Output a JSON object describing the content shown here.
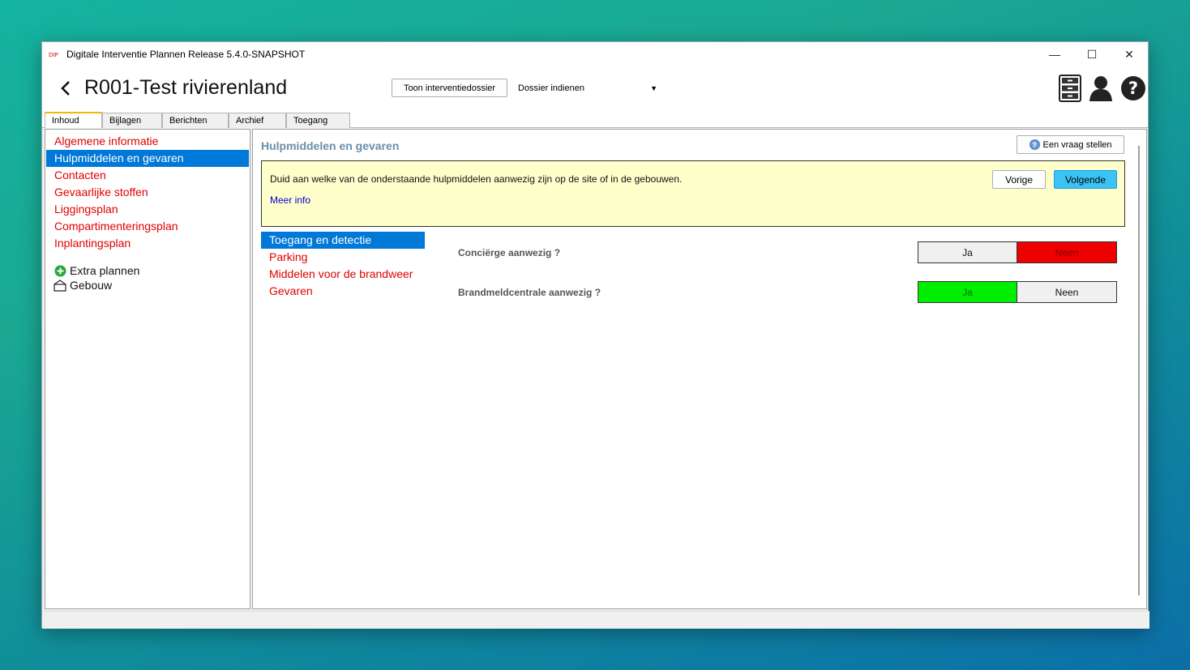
{
  "window": {
    "title": "Digitale Interventie Plannen Release 5.4.0-SNAPSHOT",
    "controls": {
      "minimize": "—",
      "maximize": "☐",
      "close": "✕"
    }
  },
  "header": {
    "back_icon": "chevron-left-icon",
    "title": "R001-Test rivierenland",
    "show_dossier_label": "Toon interventiedossier",
    "dossier_select": "Dossier indienen",
    "icons": [
      "cabinet-icon",
      "user-icon",
      "help-icon"
    ]
  },
  "tabs": [
    {
      "label": "Inhoud",
      "active": true
    },
    {
      "label": "Bijlagen",
      "active": false
    },
    {
      "label": "Berichten",
      "active": false
    },
    {
      "label": "Archief",
      "active": false
    },
    {
      "label": "Toegang",
      "active": false
    }
  ],
  "sidebar": {
    "items": [
      {
        "label": "Algemene informatie"
      },
      {
        "label": "Hulpmiddelen en gevaren",
        "selected": true
      },
      {
        "label": "Contacten"
      },
      {
        "label": "Gevaarlijke stoffen"
      },
      {
        "label": "Liggingsplan"
      },
      {
        "label": "Compartimenteringsplan"
      },
      {
        "label": "Inplantingsplan"
      }
    ],
    "extra_plans": "Extra plannen",
    "building": "Gebouw"
  },
  "main": {
    "section_title": "Hulpmiddelen en gevaren",
    "ask_question": "Een vraag stellen",
    "info_text": "Duid aan welke van de onderstaande hulpmiddelen aanwezig zijn op de site of in de gebouwen.",
    "more_info": "Meer info",
    "prev": "Vorige",
    "next": "Volgende",
    "subnav": [
      {
        "label": "Toegang en detectie",
        "selected": true
      },
      {
        "label": "Parking"
      },
      {
        "label": "Middelen voor de brandweer"
      },
      {
        "label": "Gevaren"
      }
    ],
    "questions": [
      {
        "label": "Conciërge aanwezig ?",
        "yes": "Ja",
        "no": "Neen",
        "answer": "Neen"
      },
      {
        "label": "Brandmeldcentrale aanwezig ?",
        "yes": "Ja",
        "no": "Neen",
        "answer": "Ja"
      }
    ]
  },
  "colors": {
    "selected": "#0078d7",
    "link_red": "#e00000",
    "yes_green": "#00ee00",
    "no_red": "#ee0000",
    "info_bg": "#ffffcc",
    "next_button": "#3cc3f5"
  }
}
